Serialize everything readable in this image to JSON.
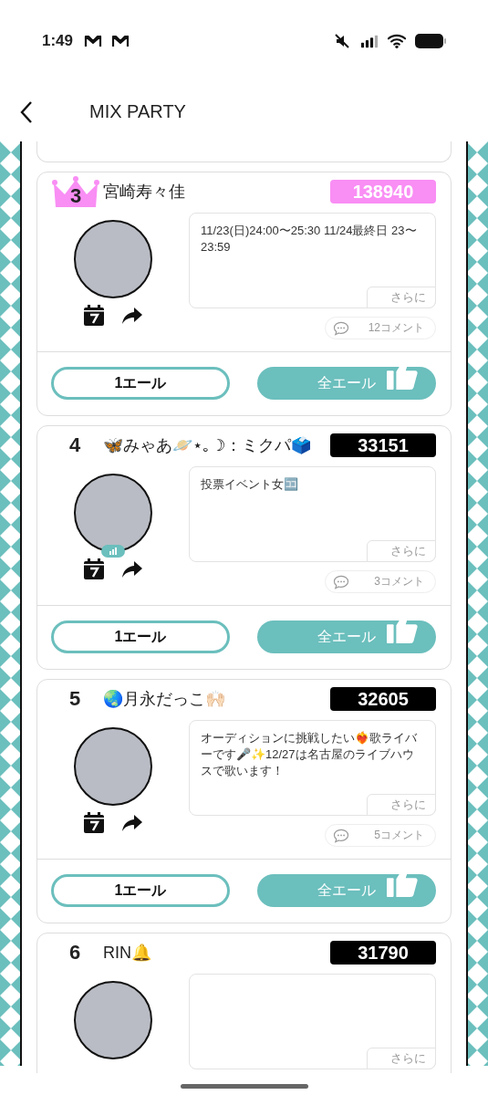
{
  "status_bar": {
    "time": "1:49"
  },
  "header": {
    "title": "MIX PARTY"
  },
  "entries": [
    {
      "rank": "3",
      "kind": "crown",
      "name": "宮崎寿々佳",
      "score": "138940",
      "color": "#f98ef4",
      "live": false,
      "description": "11/23(日)24:00〜25:30 11/24最終日 23〜23:59",
      "more": "さらに",
      "comments": "12コメント",
      "buttons": [
        "1エール",
        "全エール"
      ]
    },
    {
      "rank": "4",
      "kind": "plain",
      "name": "🦋みゃあ🪐⋆｡☽：ミクパ🗳️",
      "score": "33151",
      "color": "#000000",
      "live": true,
      "description": "投票イベント女🈁",
      "more": "さらに",
      "comments": "3コメント",
      "buttons": [
        "1エール",
        "全エール"
      ]
    },
    {
      "rank": "5",
      "kind": "plain",
      "name": "🌏月永だっこ🙌🏻",
      "score": "32605",
      "color": "#000000",
      "live": false,
      "description": "オーディションに挑戦したい❤️‍🔥歌ライバーです🎤✨12/27は名古屋のライブハウスで歌います！",
      "more": "さらに",
      "comments": "5コメント",
      "buttons": [
        "1エール",
        "全エール"
      ]
    },
    {
      "rank": "6",
      "kind": "plain",
      "name": "RIN🔔",
      "score": "31790",
      "color": "#000000",
      "live": false,
      "more": "さらに"
    }
  ]
}
